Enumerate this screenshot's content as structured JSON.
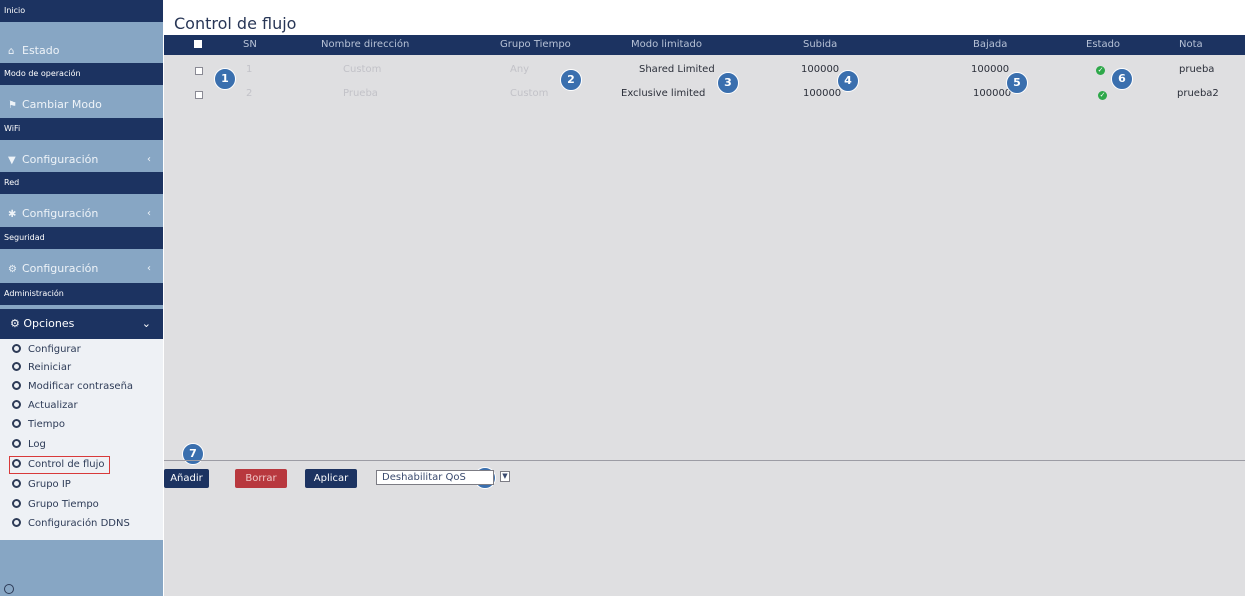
{
  "sidebar": {
    "sections": [
      {
        "header": "Inicio",
        "item": "Estado",
        "icon": "home-icon"
      },
      {
        "header": "Modo de operación",
        "item": "Cambiar Modo",
        "icon": "flag-icon"
      },
      {
        "header": "WiFi",
        "item": "Configuración",
        "icon": "wifi-cog-icon"
      },
      {
        "header": "Red",
        "item": "Configuración",
        "icon": "network-cog-icon"
      },
      {
        "header": "Seguridad",
        "item": "Configuración",
        "icon": "cog-icon"
      },
      {
        "header": "Administración",
        "item": "Opciones",
        "icon": "gear-icon"
      }
    ],
    "submenu": [
      "Configurar",
      "Reiniciar",
      "Modificar contraseña",
      "Actualizar",
      "Tiempo",
      "Log",
      "Control de flujo",
      "Grupo IP",
      "Grupo Tiempo",
      "Configuración DDNS"
    ],
    "active_item": "Control de flujo"
  },
  "page": {
    "title": "Control de flujo"
  },
  "table": {
    "columns": [
      "SN",
      "Nombre dirección",
      "Grupo Tiempo",
      "Modo limitado",
      "Subida",
      "Bajada",
      "Estado",
      "Nota"
    ],
    "rows": [
      {
        "sn": "1",
        "nombre": "Custom",
        "grupo": "Any",
        "modo": "Shared Limited",
        "subida": "100000",
        "bajada": "100000",
        "estado": "enabled",
        "nota": "prueba"
      },
      {
        "sn": "2",
        "nombre": "Prueba",
        "grupo": "Custom",
        "modo": "Exclusive limited",
        "subida": "100000",
        "bajada": "100000",
        "estado": "enabled",
        "nota": "prueba2"
      }
    ]
  },
  "actions": {
    "add": "Añadir",
    "delete": "Borrar",
    "apply": "Aplicar",
    "qos_select": "Deshabilitar QoS"
  },
  "badges": [
    "1",
    "2",
    "3",
    "4",
    "5",
    "6",
    "7",
    "8"
  ],
  "colors": {
    "navy": "#1c3361",
    "sidebar": "#87a6c4",
    "badge": "#3a6fae",
    "delete": "#b8383e",
    "ok": "#2ea84a",
    "highlight": "#d83a3a"
  }
}
